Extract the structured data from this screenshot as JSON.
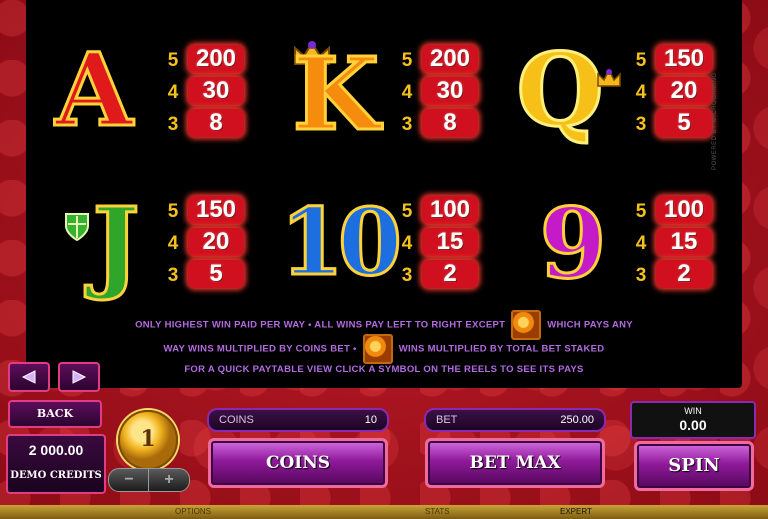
{
  "paytable": {
    "symbols": [
      {
        "label": "A",
        "color": "#e01a1a",
        "pays": [
          {
            "count": "5",
            "value": "200"
          },
          {
            "count": "4",
            "value": "30"
          },
          {
            "count": "3",
            "value": "8"
          }
        ]
      },
      {
        "label": "K",
        "color": "#f58c0e",
        "pays": [
          {
            "count": "5",
            "value": "200"
          },
          {
            "count": "4",
            "value": "30"
          },
          {
            "count": "3",
            "value": "8"
          }
        ]
      },
      {
        "label": "Q",
        "color": "#f6c019",
        "pays": [
          {
            "count": "5",
            "value": "150"
          },
          {
            "count": "4",
            "value": "20"
          },
          {
            "count": "3",
            "value": "5"
          }
        ]
      },
      {
        "label": "J",
        "color": "#2fa52a",
        "pays": [
          {
            "count": "5",
            "value": "150"
          },
          {
            "count": "4",
            "value": "20"
          },
          {
            "count": "3",
            "value": "5"
          }
        ]
      },
      {
        "label": "10",
        "color": "#1d6fe0",
        "pays": [
          {
            "count": "5",
            "value": "100"
          },
          {
            "count": "4",
            "value": "15"
          },
          {
            "count": "3",
            "value": "2"
          }
        ]
      },
      {
        "label": "9",
        "color": "#c51ac8",
        "pays": [
          {
            "count": "5",
            "value": "100"
          },
          {
            "count": "4",
            "value": "15"
          },
          {
            "count": "3",
            "value": "2"
          }
        ]
      }
    ],
    "info": {
      "line1_a": "ONLY HIGHEST WIN PAID PER WAY  •  ALL WINS PAY LEFT TO RIGHT EXCEPT",
      "line1_b": "WHICH PAYS ANY",
      "line2_a": "WAY WINS MULTIPLIED BY COINS BET  •",
      "line2_b": "WINS MULTIPLIED BY TOTAL BET STAKED",
      "line3": "FOR A QUICK PAYTABLE VIEW CLICK A SYMBOL ON THE REELS TO SEE ITS PAYS"
    },
    "side_text": "POWERED BY MICROGAMING"
  },
  "controls": {
    "prev_icon": "arrow-left",
    "next_icon": "arrow-right",
    "back_label": "BACK",
    "credits_value": "2 000.00",
    "credits_label": "DEMO CREDITS",
    "coin_value": "1",
    "coins_label": "COINS",
    "coins_value": "10",
    "bet_label": "BET",
    "bet_value": "250.00",
    "coins_button": "COINS",
    "betmax_button": "BET MAX",
    "win_label": "WIN",
    "win_value": "0.00",
    "spin_button": "SPIN"
  },
  "bottom_bar": {
    "options": "OPTIONS",
    "stats": "STATS",
    "expert": "EXPERT"
  }
}
